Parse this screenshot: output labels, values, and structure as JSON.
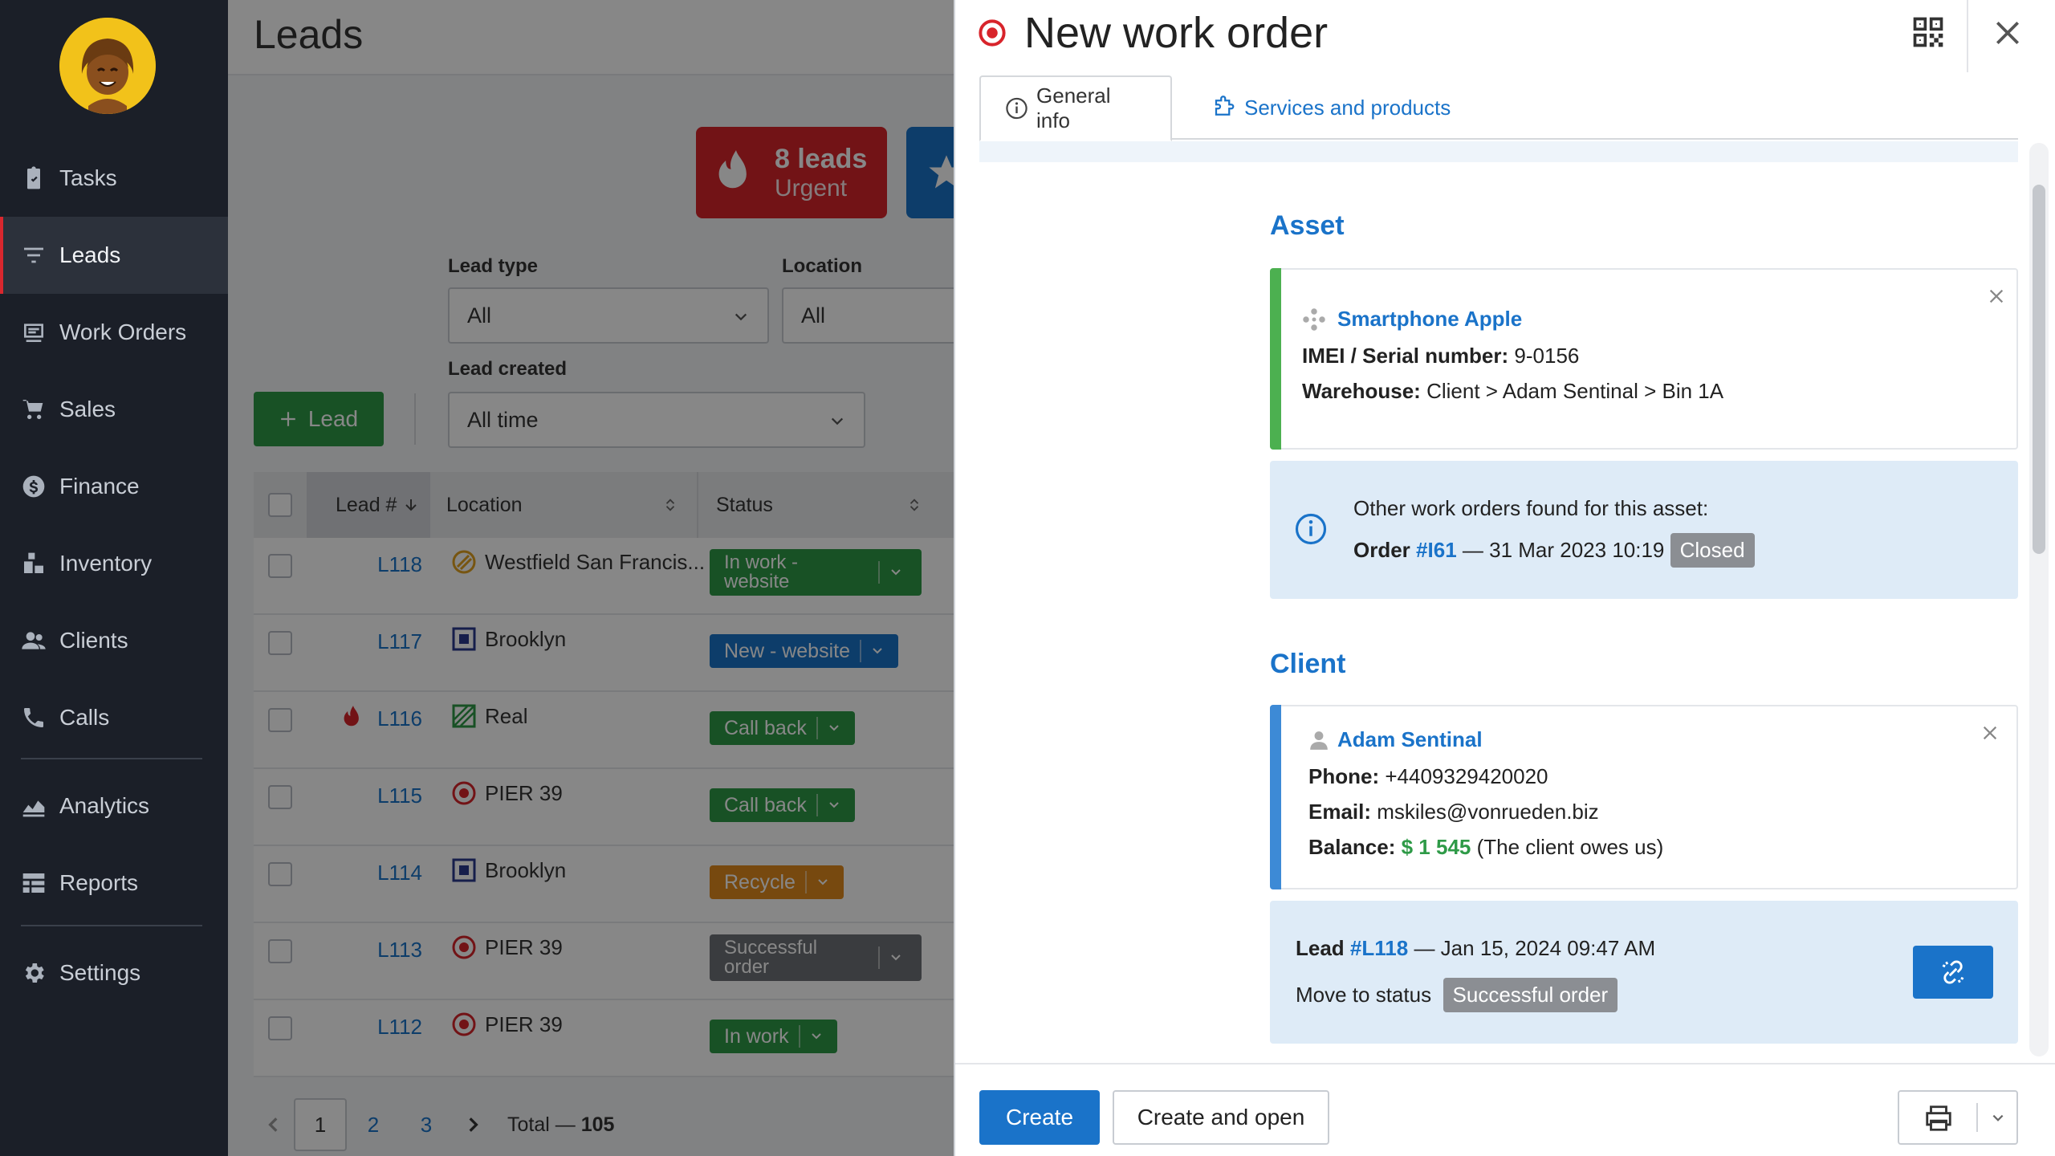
{
  "sidebar": {
    "items": [
      {
        "label": "Tasks",
        "icon": "clipboard-check-icon"
      },
      {
        "label": "Leads",
        "icon": "funnel-icon"
      },
      {
        "label": "Work Orders",
        "icon": "work-order-icon"
      },
      {
        "label": "Sales",
        "icon": "cart-icon"
      },
      {
        "label": "Finance",
        "icon": "dollar-coin-icon"
      },
      {
        "label": "Inventory",
        "icon": "boxes-icon"
      },
      {
        "label": "Clients",
        "icon": "users-icon"
      },
      {
        "label": "Calls",
        "icon": "phone-icon"
      },
      {
        "label": "Analytics",
        "icon": "chart-area-icon"
      },
      {
        "label": "Reports",
        "icon": "list-icon"
      },
      {
        "label": "Settings",
        "icon": "gear-icon"
      }
    ],
    "active": "Leads"
  },
  "leads_page": {
    "title": "Leads",
    "kpi_urgent": {
      "count": "8 leads",
      "label": "Urgent"
    },
    "filters": {
      "lead_type_label": "Lead type",
      "lead_type_value": "All",
      "location_label": "Location",
      "location_value": "All",
      "lead_created_label": "Lead created",
      "lead_created_value": "All time"
    },
    "add_lead_label": "Lead",
    "columns": {
      "lead": "Lead #",
      "location": "Location",
      "status": "Status"
    },
    "rows": [
      {
        "lead": "L118",
        "location": "Westfield San Francis...",
        "status_line1": "In work -",
        "status_line2": "website"
      },
      {
        "lead": "L117",
        "location": "Brooklyn",
        "status_line1": "New - website",
        "status_line2": ""
      },
      {
        "lead": "L116",
        "location": "Real",
        "status_line1": "Call back",
        "status_line2": ""
      },
      {
        "lead": "L115",
        "location": "PIER 39",
        "status_line1": "Call back",
        "status_line2": ""
      },
      {
        "lead": "L114",
        "location": "Brooklyn",
        "status_line1": "Recycle",
        "status_line2": ""
      },
      {
        "lead": "L113",
        "location": "PIER 39",
        "status_line1": "Successful",
        "status_line2": "order"
      },
      {
        "lead": "L112",
        "location": "PIER 39",
        "status_line1": "In work",
        "status_line2": ""
      }
    ],
    "pagination": {
      "pages": [
        "1",
        "2",
        "3"
      ],
      "current": "1",
      "total_label": "Total —",
      "total": "105"
    }
  },
  "panel": {
    "title": "New work order",
    "tabs": {
      "general": "General info",
      "services": "Services and products"
    },
    "asset": {
      "section_title": "Asset",
      "name": "Smartphone Apple",
      "imei_label": "IMEI / Serial number:",
      "imei_value": "9-0156",
      "warehouse_label": "Warehouse:",
      "warehouse_value": "Client > Adam Sentinal > Bin 1A"
    },
    "other_orders": {
      "heading": "Other work orders found for this asset:",
      "order_label": "Order",
      "order_link": "#I61",
      "order_date": "— 31 Mar 2023 10:19",
      "order_status": "Closed"
    },
    "client": {
      "section_title": "Client",
      "name": "Adam Sentinal",
      "phone_label": "Phone:",
      "phone_value": "+4409329420020",
      "email_label": "Email:",
      "email_value": "mskiles@vonrueden.biz",
      "balance_label": "Balance:",
      "balance_amount": "$ 1 545",
      "balance_note": "(The client owes us)"
    },
    "lead_link": {
      "label": "Lead",
      "link": "#L118",
      "date": "— Jan 15, 2024 09:47 AM",
      "move_label": "Move to status",
      "move_status": "Successful order"
    },
    "footer": {
      "create": "Create",
      "create_open": "Create and open"
    }
  },
  "colors": {
    "accent_blue": "#1a73c9",
    "urgent_red": "#d8242b",
    "success_green": "#2e9a47",
    "sidebar_bg": "#1b1f28",
    "info_bg": "#deebf7"
  }
}
